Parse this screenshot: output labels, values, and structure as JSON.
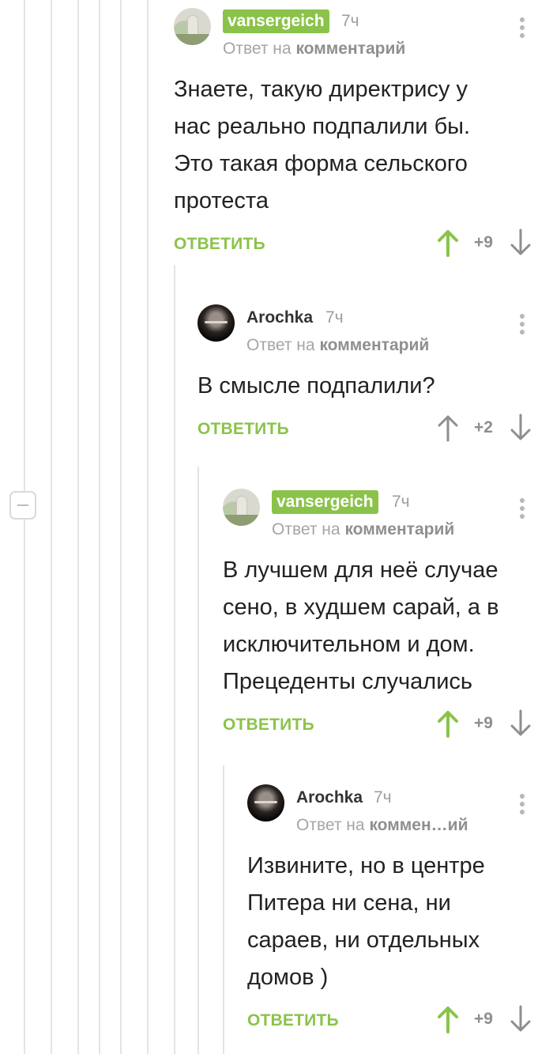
{
  "colors": {
    "accent_green": "#8bc34a",
    "thread_line": "#e4e4e4",
    "muted_text": "#9e9e9e"
  },
  "thread": {
    "collapse_icon": "minus-icon"
  },
  "comments": [
    {
      "author": "vansergeich",
      "author_highlighted": true,
      "avatar_icon": "user-avatar-photo",
      "time": "7ч",
      "reply_prefix": "Ответ на",
      "reply_link": "комментарий",
      "text": "Знаете, такую директрису у нас реально подпалили бы. Это такая форма сельского протеста",
      "reply_label": "ОТВЕТИТЬ",
      "score": "+9",
      "upvoted": true
    },
    {
      "author": "Arochka",
      "author_highlighted": false,
      "avatar_icon": "user-avatar-photo",
      "time": "7ч",
      "reply_prefix": "Ответ на",
      "reply_link": "комментарий",
      "text": "В смысле подпалили?",
      "reply_label": "ОТВЕТИТЬ",
      "score": "+2",
      "upvoted": false
    },
    {
      "author": "vansergeich",
      "author_highlighted": true,
      "avatar_icon": "user-avatar-photo",
      "time": "7ч",
      "reply_prefix": "Ответ на",
      "reply_link": "комментарий",
      "text": "В лучшем для неё случае сено, в худшем сарай, а в исключительном и дом. Прецеденты случались",
      "reply_label": "ОТВЕТИТЬ",
      "score": "+9",
      "upvoted": true
    },
    {
      "author": "Arochka",
      "author_highlighted": false,
      "avatar_icon": "user-avatar-photo",
      "time": "7ч",
      "reply_prefix": "Ответ на",
      "reply_link": "коммен…ий",
      "text": "Извините, но в центре Питера ни сена, ни сараев, ни отдельных домов )",
      "reply_label": "ОТВЕТИТЬ",
      "score": "+9",
      "upvoted": true
    }
  ]
}
